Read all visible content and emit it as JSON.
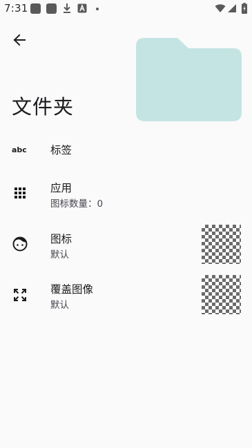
{
  "status_bar": {
    "time": "7:31"
  },
  "title": "文件夹",
  "settings": {
    "label": {
      "title": "标签"
    },
    "apps": {
      "title": "应用",
      "subtitle": "图标数量：0"
    },
    "icon": {
      "title": "图标",
      "subtitle": "默认"
    },
    "overlay": {
      "title": "覆盖图像",
      "subtitle": "默认"
    }
  },
  "colors": {
    "folder_preview": "#c4e4e3",
    "background": "#fafafa"
  }
}
